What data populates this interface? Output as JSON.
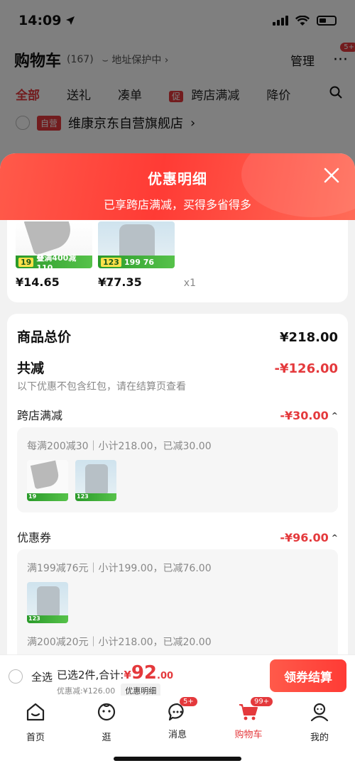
{
  "status": {
    "time": "14:09"
  },
  "header": {
    "title": "购物车",
    "count": "(167)",
    "address_protect": "地址保护中",
    "manage": "管理",
    "more_badge": "5+"
  },
  "filter_tabs": [
    "全部",
    "送礼",
    "凑单",
    "跨店满减",
    "降价"
  ],
  "filter_promo_tag": "促",
  "store": {
    "tag": "自营",
    "name": "维康京东自营旗舰店"
  },
  "sheet": {
    "title": "优惠明细",
    "subtitle": "已享跨店满减，买得多省得多"
  },
  "products": [
    {
      "price": "¥14.65",
      "qty": "x1",
      "tag_num": "19",
      "tag_text": "叠满400减110"
    },
    {
      "price": "¥77.35",
      "qty": "x1",
      "tag_num": "123",
      "tag_text": "199 76"
    }
  ],
  "summary": {
    "total_label": "商品总价",
    "total_value": "¥218.00",
    "discount_label": "共减",
    "discount_value": "-¥126.00",
    "discount_hint": "以下优惠不包含红包，请在结算页查看"
  },
  "cross_store": {
    "label": "跨店满减",
    "value": "-¥30.00",
    "rule": "每满200减30｜小计218.00，已减30.00"
  },
  "coupon": {
    "label": "优惠券",
    "value": "-¥96.00",
    "rule1": "满199减76元｜小计199.00，已减76.00",
    "rule2": "满200减20元｜小计218.00，已减20.00"
  },
  "checkout": {
    "select_all": "全选",
    "selected_text": "已选2件,合计:",
    "total_symbol": "¥",
    "total_int": "92",
    "total_dec": ".00",
    "saved_text": "优惠减:¥126.00",
    "detail_button": "优惠明细",
    "checkout_button": "领券结算"
  },
  "tabbar": [
    {
      "label": "首页",
      "badge": ""
    },
    {
      "label": "逛",
      "badge": ""
    },
    {
      "label": "消息",
      "badge": "5+"
    },
    {
      "label": "购物车",
      "badge": "99+"
    },
    {
      "label": "我的",
      "badge": ""
    }
  ],
  "colors": {
    "accent": "#e4393c",
    "promo_green": "#3aa83a"
  }
}
